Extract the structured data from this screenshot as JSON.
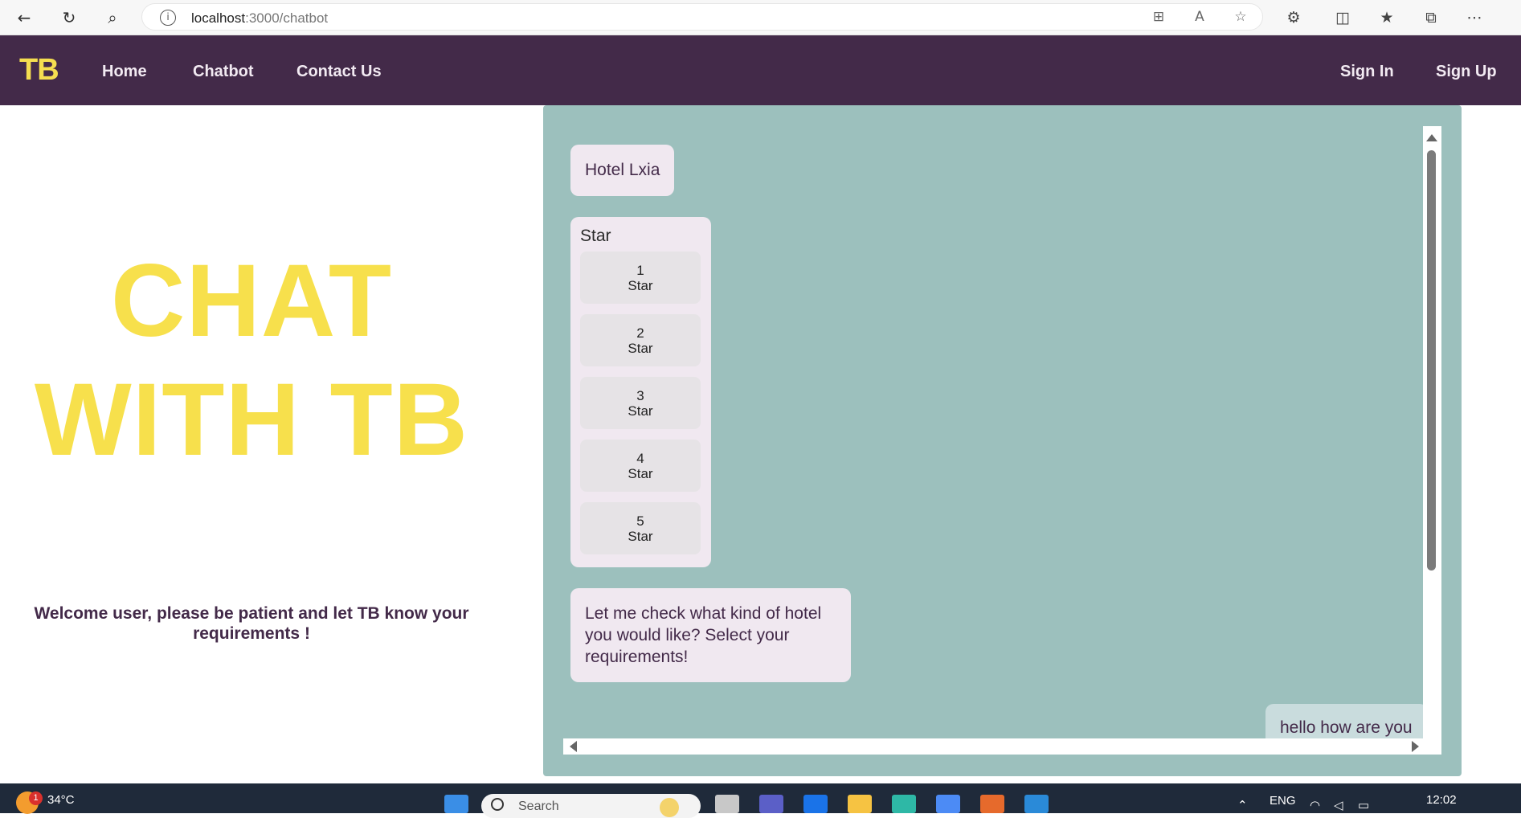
{
  "browser": {
    "url_host": "localhost",
    "url_path": ":3000/chatbot"
  },
  "navbar": {
    "brand": "TB",
    "links": [
      "Home",
      "Chatbot",
      "Contact Us"
    ],
    "sign_in": "Sign In",
    "sign_up": "Sign Up"
  },
  "hero": {
    "title_line1": "CHAT",
    "title_line2": "WITH TB",
    "subtitle": "Welcome user, please be patient and let TB know your requirements !"
  },
  "chat": {
    "messages": [
      {
        "type": "bot",
        "text": "Hotel Lxia"
      },
      {
        "type": "bot-options",
        "title": "Star",
        "options": [
          {
            "num": "1",
            "label": "Star"
          },
          {
            "num": "2",
            "label": "Star"
          },
          {
            "num": "3",
            "label": "Star"
          },
          {
            "num": "4",
            "label": "Star"
          },
          {
            "num": "5",
            "label": "Star"
          }
        ]
      },
      {
        "type": "bot",
        "text": "Let me check what kind of hotel you would like? Select your requirements!"
      },
      {
        "type": "user",
        "text": "hello how are you"
      }
    ]
  },
  "taskbar": {
    "weather_badge": "1",
    "temperature": "34°C",
    "search_placeholder": "Search",
    "language": "ENG",
    "time": "12:02"
  },
  "colors": {
    "navbar_bg": "#432a49",
    "brand": "#f5de50",
    "hero_title": "#f7e04c",
    "chat_bg": "#9cc0bd",
    "bubble_bg": "#f0e8f0"
  }
}
